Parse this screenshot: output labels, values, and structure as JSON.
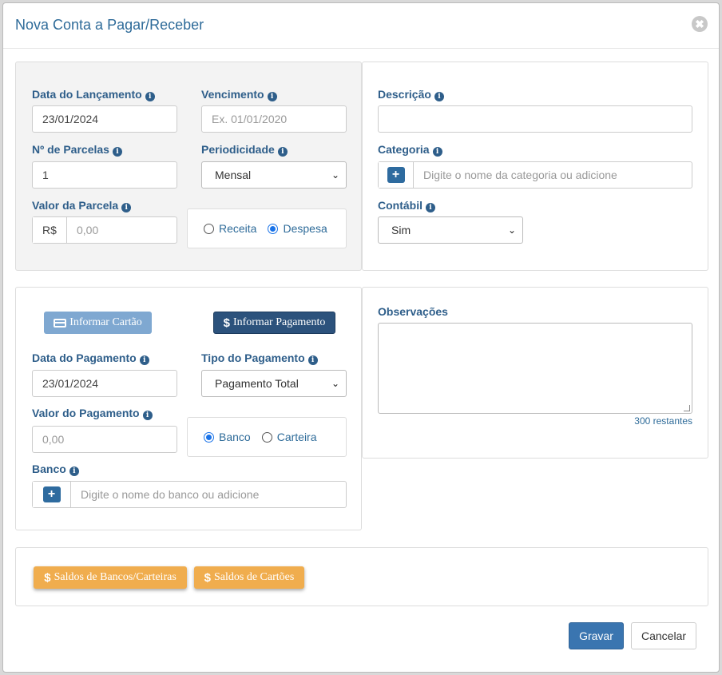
{
  "modal": {
    "title": "Nova Conta a Pagar/Receber",
    "close_glyph": "✖"
  },
  "launch": {
    "date_label": "Data do Lançamento",
    "date_value": "23/01/2024",
    "due_label": "Vencimento",
    "due_placeholder": "Ex. 01/01/2020",
    "installments_label": "Nº de Parcelas",
    "installments_value": "1",
    "periodicity_label": "Periodicidade",
    "periodicity_value": "Mensal",
    "installment_value_label": "Valor da Parcela",
    "currency_prefix": "R$",
    "installment_value_placeholder": "0,00",
    "type_options": [
      {
        "label": "Receita",
        "checked": false
      },
      {
        "label": "Despesa",
        "checked": true
      }
    ]
  },
  "details": {
    "description_label": "Descrição",
    "description_value": "",
    "category_label": "Categoria",
    "category_placeholder": "Digite o nome da categoria ou adicione",
    "accounting_label": "Contábil",
    "accounting_value": "Sim"
  },
  "payment": {
    "card_button": "Informar Cartão",
    "pay_button": "Informar Pagamento",
    "pay_date_label": "Data do Pagamento",
    "pay_date_value": "23/01/2024",
    "pay_type_label": "Tipo do Pagamento",
    "pay_type_value": "Pagamento Total",
    "pay_value_label": "Valor do Pagamento",
    "pay_value_placeholder": "0,00",
    "source_options": [
      {
        "label": "Banco",
        "checked": true
      },
      {
        "label": "Carteira",
        "checked": false
      }
    ],
    "bank_label": "Banco",
    "bank_placeholder": "Digite o nome do banco ou adicione"
  },
  "notes": {
    "label": "Observações",
    "value": "",
    "counter": "300 restantes"
  },
  "balances": {
    "banks_button": "Saldos de Bancos/Carteiras",
    "cards_button": "Saldos de Cartões"
  },
  "footer": {
    "save": "Gravar",
    "cancel": "Cancelar"
  },
  "colors": {
    "primary": "#3a75b0",
    "dark_primary": "#2c527c",
    "warning": "#f0ad4e",
    "label": "#2e5e8a"
  }
}
